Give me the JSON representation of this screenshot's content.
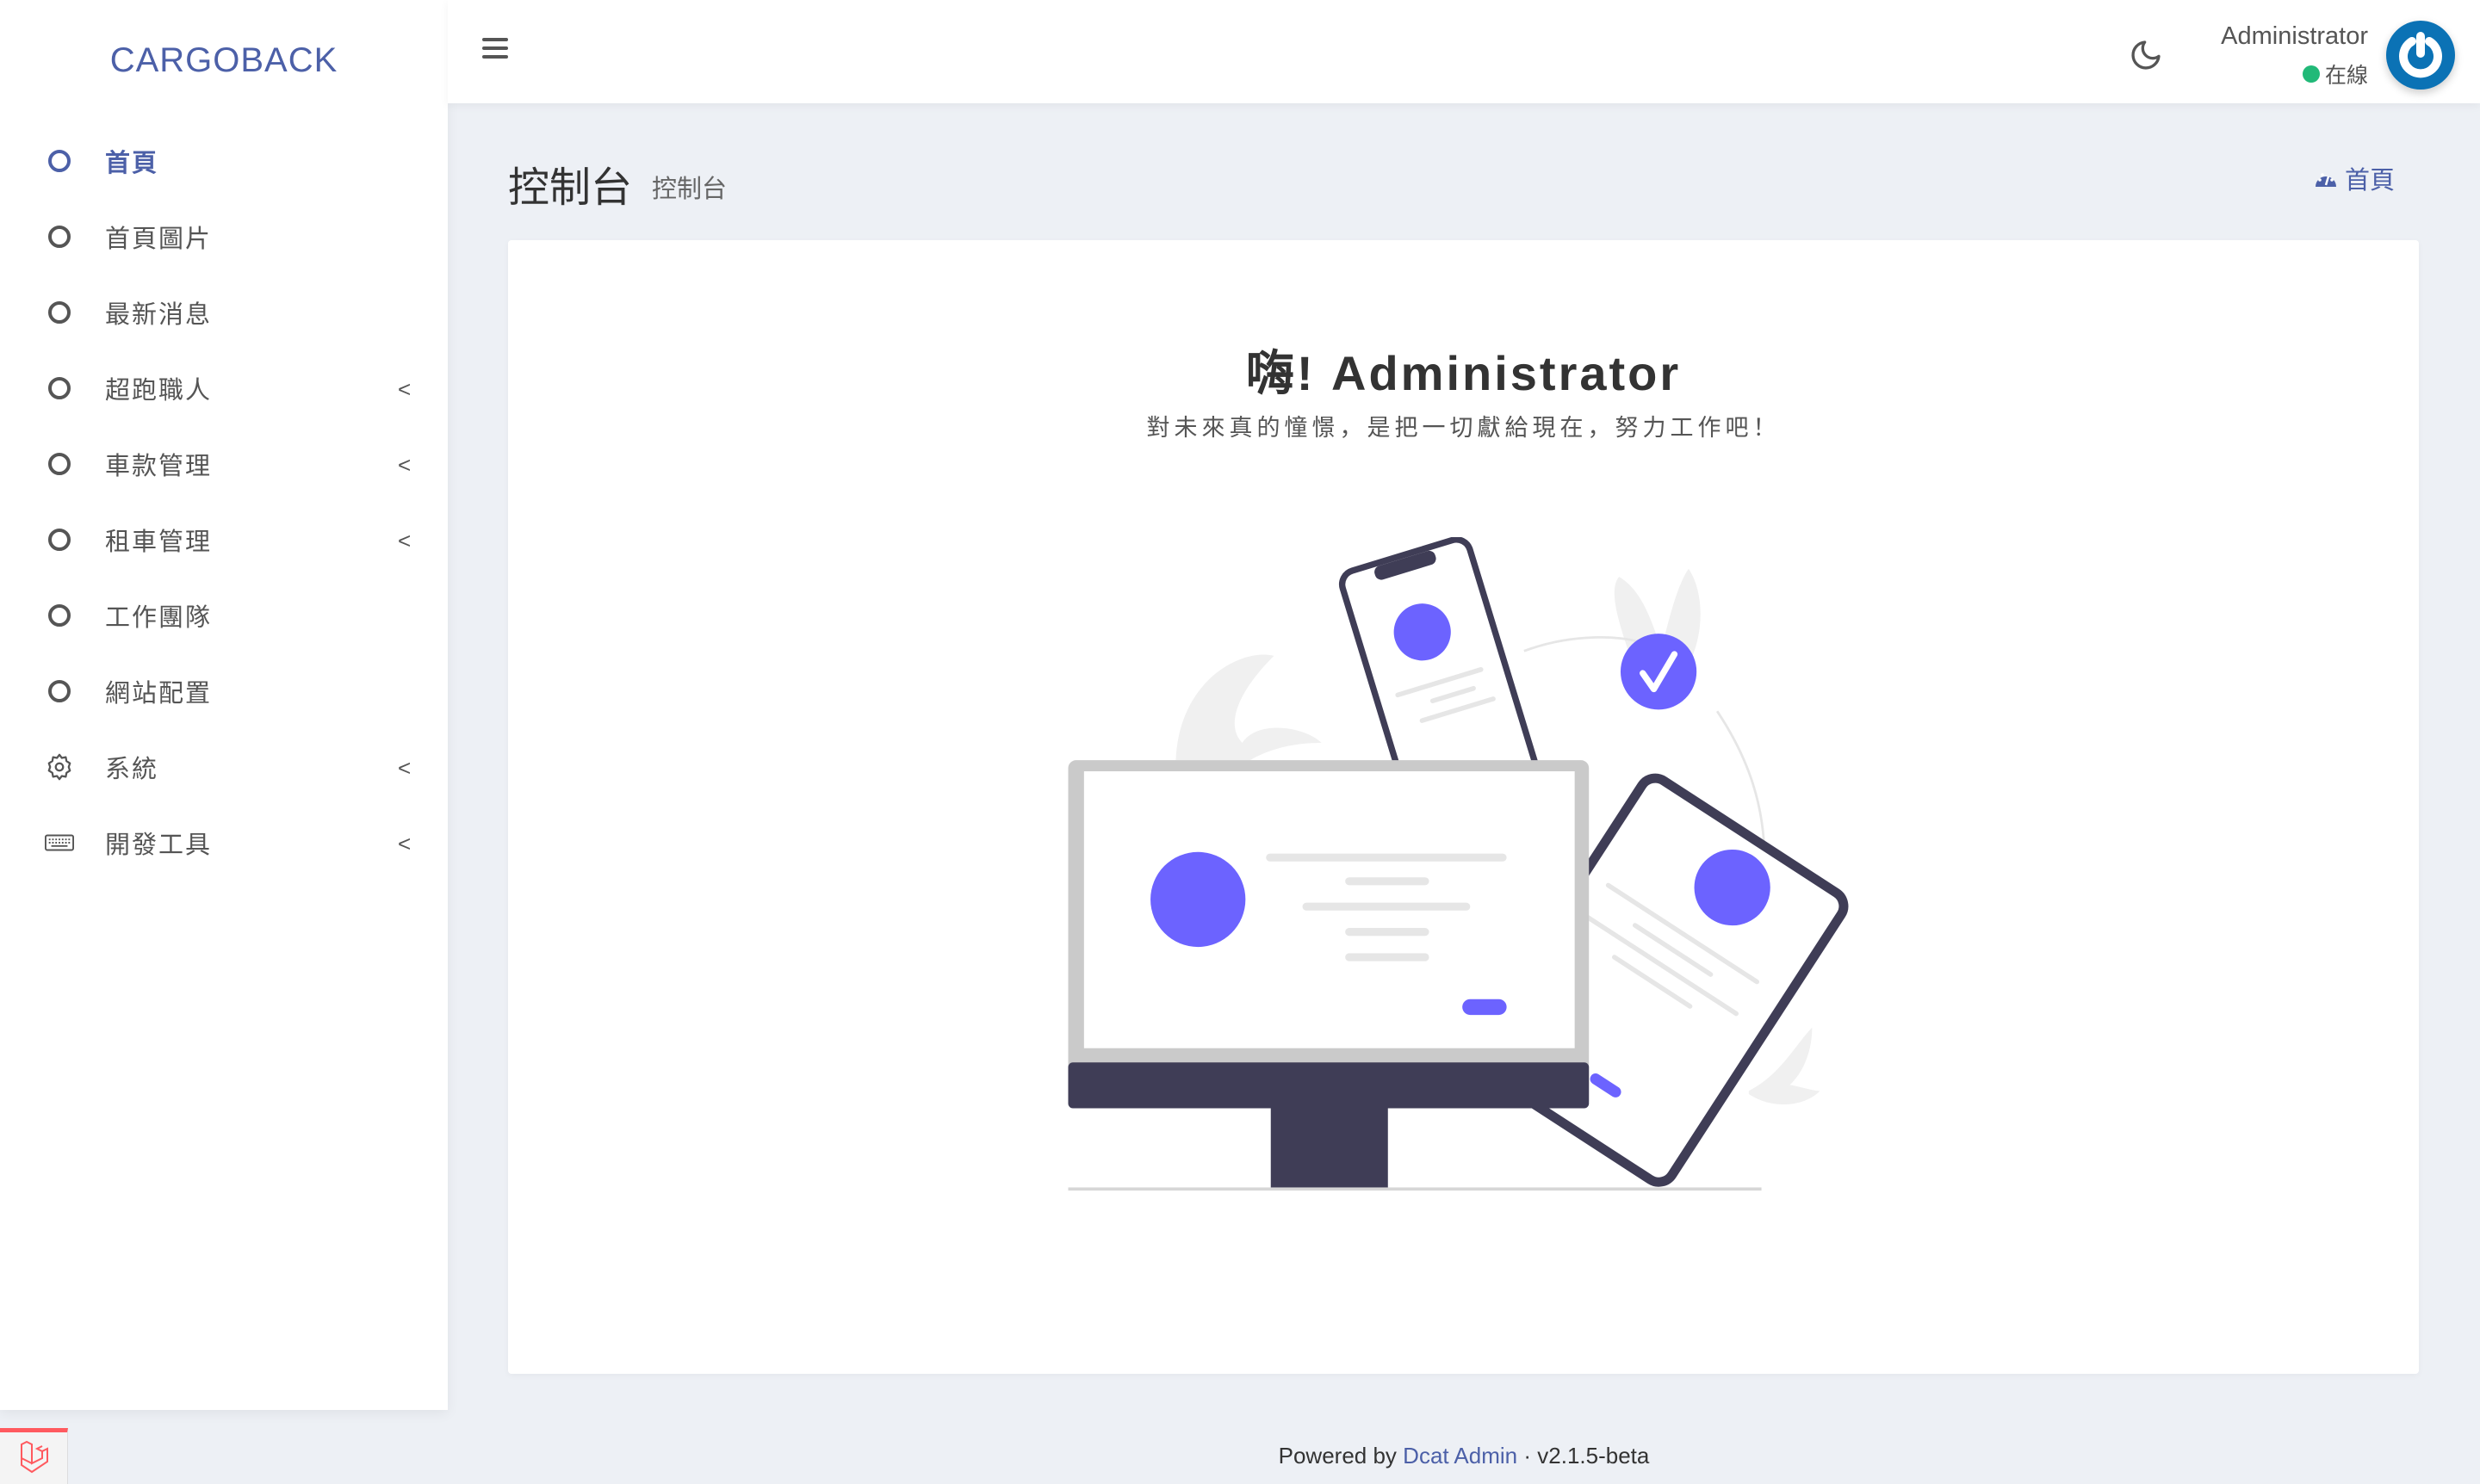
{
  "brand": "CARGOBACK",
  "sidebar": {
    "items": [
      {
        "label": "首頁",
        "icon": "circle-icon",
        "active": true,
        "chevron": false
      },
      {
        "label": "首頁圖片",
        "icon": "circle-icon",
        "chevron": false
      },
      {
        "label": "最新消息",
        "icon": "circle-icon",
        "chevron": false
      },
      {
        "label": "超跑職人",
        "icon": "circle-icon",
        "chevron": true
      },
      {
        "label": "車款管理",
        "icon": "circle-icon",
        "chevron": true
      },
      {
        "label": "租車管理",
        "icon": "circle-icon",
        "chevron": true
      },
      {
        "label": "工作團隊",
        "icon": "circle-icon",
        "chevron": false
      },
      {
        "label": "網站配置",
        "icon": "circle-icon",
        "chevron": false
      },
      {
        "label": "系統",
        "icon": "gear-icon",
        "chevron": true
      },
      {
        "label": "開發工具",
        "icon": "keyboard-icon",
        "chevron": true
      }
    ],
    "chevron_glyph": "<"
  },
  "header": {
    "user_name": "Administrator",
    "status": "在線"
  },
  "page": {
    "title": "控制台",
    "subtitle": "控制台",
    "breadcrumb": "首頁"
  },
  "card": {
    "greeting": "嗨!  Administrator",
    "motto": "對未來真的憧憬，是把一切獻給現在，努力工作吧！"
  },
  "footer": {
    "powered": "Powered by",
    "link": "Dcat Admin",
    "sep": "·",
    "version": "v2.1.5-beta"
  },
  "colors": {
    "accent": "#4c60a8",
    "illustration": "#6c63ff",
    "dark": "#3f3d56",
    "online": "#21b978"
  }
}
